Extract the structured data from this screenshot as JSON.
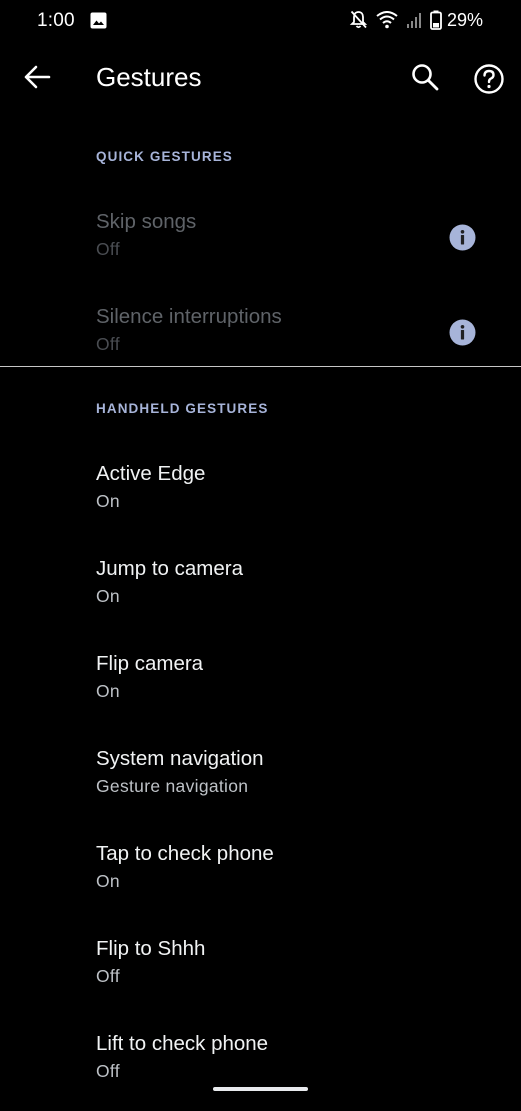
{
  "status_bar": {
    "time": "1:00",
    "battery_percent": "29%",
    "icons": [
      "image-icon",
      "notifications-off-icon",
      "wifi-icon",
      "signal-icon",
      "battery-icon"
    ]
  },
  "app_bar": {
    "title": "Gestures",
    "icons": [
      "back-arrow-icon",
      "search-icon",
      "help-icon"
    ]
  },
  "sections": {
    "quick": {
      "header": "QUICK GESTURES",
      "items": [
        {
          "title": "Skip songs",
          "summary": "Off",
          "enabled": false
        },
        {
          "title": "Silence interruptions",
          "summary": "Off",
          "enabled": false
        }
      ]
    },
    "handheld": {
      "header": "HANDHELD GESTURES",
      "items": [
        {
          "title": "Active Edge",
          "summary": "On"
        },
        {
          "title": "Jump to camera",
          "summary": "On"
        },
        {
          "title": "Flip camera",
          "summary": "On"
        },
        {
          "title": "System navigation",
          "summary": "Gesture navigation"
        },
        {
          "title": "Tap to check phone",
          "summary": "On"
        },
        {
          "title": "Flip to Shhh",
          "summary": "Off"
        },
        {
          "title": "Lift to check phone",
          "summary": "Off"
        }
      ]
    }
  },
  "colors": {
    "background": "#000000",
    "section_header": "#a7b4d9",
    "info_icon": "#a7b4d9",
    "title_text": "#f1f3f4",
    "summary_text": "#bdc1c6",
    "disabled_text": "#5f6368"
  }
}
